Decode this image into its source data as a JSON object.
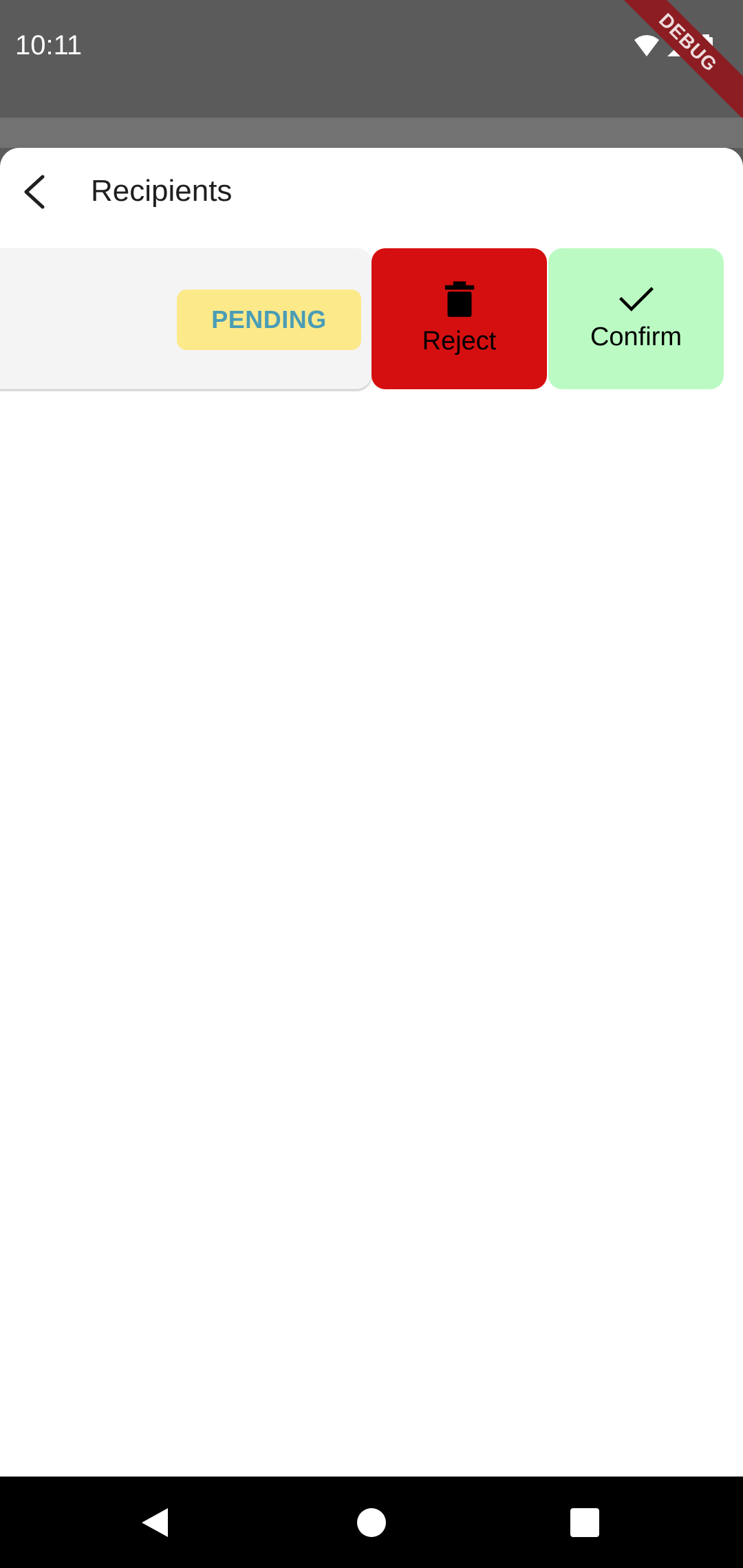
{
  "status_bar": {
    "time": "10:11",
    "debug_label": "DEBUG",
    "icons": [
      "wifi-icon",
      "cellular-signal-icon",
      "battery-icon"
    ]
  },
  "app_bar": {
    "title": "Recipients",
    "back_icon": "arrow-back-icon"
  },
  "recipients": [
    {
      "status": "PENDING",
      "status_colors": {
        "background": "#fce98a",
        "text": "#4a9db5"
      }
    }
  ],
  "swipe_actions": {
    "reject": {
      "label": "Reject",
      "icon": "trash-icon",
      "color": "#d50f10"
    },
    "confirm": {
      "label": "Confirm",
      "icon": "checkmark-icon",
      "color": "#bbfbc3"
    }
  },
  "nav_bar": {
    "icons": [
      "back-triangle-icon",
      "home-circle-icon",
      "recents-square-icon"
    ]
  }
}
